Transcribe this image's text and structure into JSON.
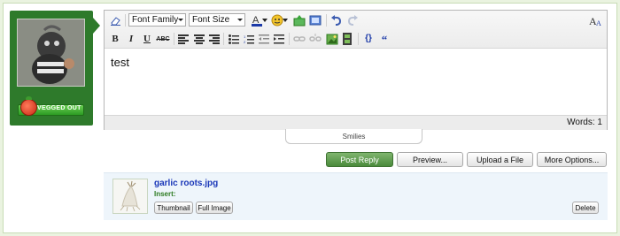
{
  "badge": {
    "text": "VEGGED OUT"
  },
  "editor": {
    "font_family": "Font Family",
    "font_size": "Font Size",
    "content": "test",
    "word_count": "Words: 1",
    "smilies_label": "Smilies"
  },
  "actions": {
    "post_reply": "Post Reply",
    "preview": "Preview...",
    "upload": "Upload a File",
    "more_options": "More Options..."
  },
  "attachment": {
    "filename": "garlic roots.jpg",
    "insert_label": "Insert:",
    "thumbnail_label": "Thumbnail",
    "full_image_label": "Full Image",
    "delete_label": "Delete"
  },
  "colors": {
    "user_panel": "#2e7a2b",
    "post_reply": "#5e9c4d",
    "filename_link": "#1a37b8",
    "insert_label": "#2c7a20"
  }
}
